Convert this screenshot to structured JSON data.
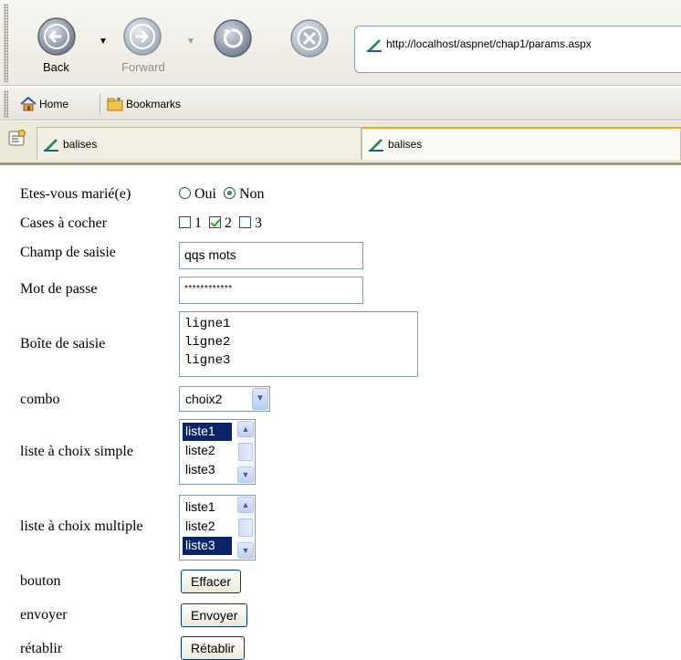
{
  "browser": {
    "nav": {
      "back_label": "Back",
      "forward_label": "Forward"
    },
    "address": {
      "url": "http://localhost/aspnet/chap1/params.aspx"
    },
    "bookmarks_bar": {
      "home_label": "Home",
      "bookmarks_label": "Bookmarks"
    },
    "tabs": [
      {
        "label": "balises"
      },
      {
        "label": "balises"
      }
    ]
  },
  "form": {
    "married": {
      "label": "Etes-vous marié(e)",
      "options": [
        "Oui",
        "Non"
      ],
      "selected": "Non"
    },
    "checkboxes": {
      "label": "Cases à cocher",
      "items": [
        {
          "label": "1",
          "checked": false
        },
        {
          "label": "2",
          "checked": true
        },
        {
          "label": "3",
          "checked": false
        }
      ]
    },
    "text_field": {
      "label": "Champ de saisie",
      "value": "qqs mots"
    },
    "password": {
      "label": "Mot de passe",
      "value": "************"
    },
    "textarea": {
      "label": "Boîte de saisie",
      "lines": [
        "ligne1",
        "ligne2",
        "ligne3"
      ]
    },
    "combo": {
      "label": "combo",
      "value": "choix2"
    },
    "single_list": {
      "label": "liste à choix simple",
      "options": [
        "liste1",
        "liste2",
        "liste3"
      ],
      "selected": "liste1"
    },
    "multi_list": {
      "label": "liste à choix multiple",
      "options": [
        "liste1",
        "liste2",
        "liste3"
      ],
      "selected": [
        "liste3"
      ]
    },
    "button": {
      "label": "bouton",
      "value": "Effacer"
    },
    "submit": {
      "label": "envoyer",
      "value": "Envoyer"
    },
    "reset": {
      "label": "rétablir",
      "value": "Rétablir"
    }
  },
  "colors": {
    "selection": "#0a246a",
    "check_green": "#21a121",
    "input_border": "#7f9db9",
    "tab_accent": "#f5a623"
  }
}
